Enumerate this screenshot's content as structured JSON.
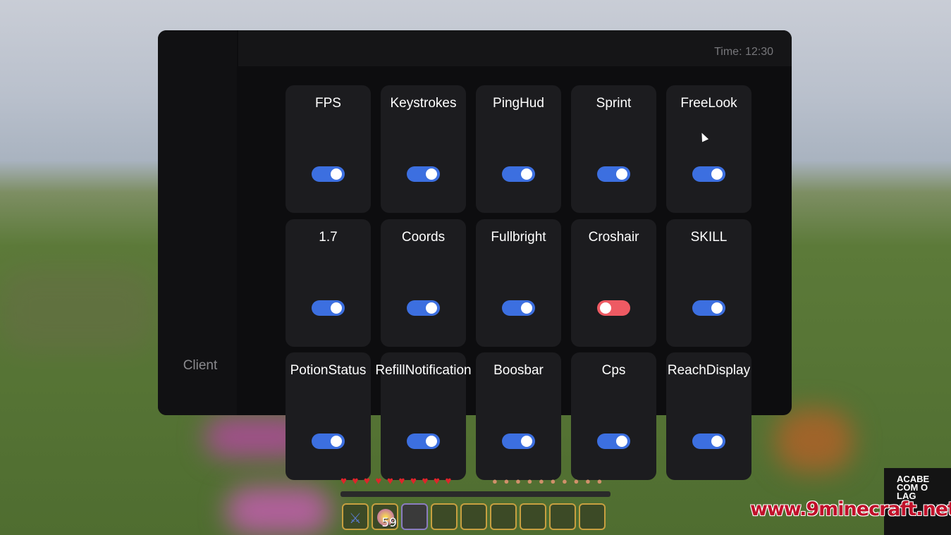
{
  "header": {
    "time": "Time: 12:30"
  },
  "sidebar": {
    "items": [
      {
        "label": "Client"
      }
    ]
  },
  "modules": [
    {
      "label": "FPS",
      "enabled": true
    },
    {
      "label": "Keystrokes",
      "enabled": true
    },
    {
      "label": "PingHud",
      "enabled": true
    },
    {
      "label": "Sprint",
      "enabled": true
    },
    {
      "label": "FreeLook",
      "enabled": true
    },
    {
      "label": "1.7",
      "enabled": true
    },
    {
      "label": "Coords",
      "enabled": true
    },
    {
      "label": "Fullbright",
      "enabled": true
    },
    {
      "label": "Croshair",
      "enabled": false
    },
    {
      "label": "SKILL",
      "enabled": true
    },
    {
      "label": "PotionStatus",
      "enabled": true
    },
    {
      "label": "RefillNotification",
      "enabled": true
    },
    {
      "label": "Boosbar",
      "enabled": true
    },
    {
      "label": "Cps",
      "enabled": true
    },
    {
      "label": "ReachDisplay",
      "enabled": true
    }
  ],
  "colors": {
    "toggle_on": "#3c6fe0",
    "toggle_off": "#ee5a63",
    "panel": "#0d0d0f",
    "card": "#1c1c1f"
  },
  "hud": {
    "hotbar": [
      {
        "icon": "sword-icon",
        "count": ""
      },
      {
        "icon": "experience-orb-icon",
        "count": "59"
      },
      {
        "icon": "",
        "count": ""
      },
      {
        "icon": "",
        "count": ""
      },
      {
        "icon": "",
        "count": ""
      },
      {
        "icon": "",
        "count": ""
      },
      {
        "icon": "",
        "count": ""
      },
      {
        "icon": "",
        "count": ""
      },
      {
        "icon": "",
        "count": ""
      }
    ],
    "selected_slot": 3
  },
  "watermark": {
    "badge": "ACABE COM O LAG",
    "site": "www.9minecraft.net"
  }
}
